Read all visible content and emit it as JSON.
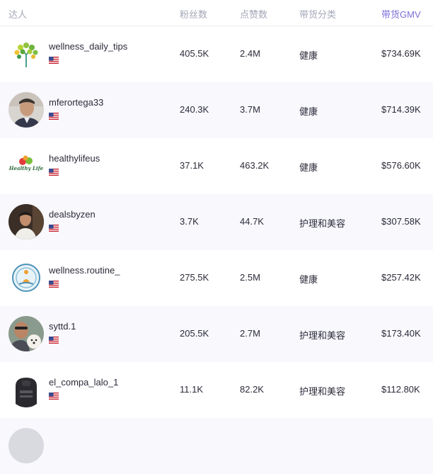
{
  "columns": {
    "creator": "达人",
    "followers": "粉丝数",
    "likes": "点赞数",
    "category": "带货分类",
    "gmv": "带货GMV"
  },
  "colors": {
    "accent": "#7b6fd8",
    "header_text": "#a3a7b7",
    "row_alt": "#f8f8fd"
  },
  "rows": [
    {
      "name": "wellness_daily_tips",
      "country_icon": "us-flag-icon",
      "followers": "405.5K",
      "likes": "2.4M",
      "category": "健康",
      "gmv": "$734.69K"
    },
    {
      "name": "mferortega33",
      "country_icon": "us-flag-icon",
      "followers": "240.3K",
      "likes": "3.7M",
      "category": "健康",
      "gmv": "$714.39K"
    },
    {
      "name": "healthylifeus",
      "country_icon": "us-flag-icon",
      "followers": "37.1K",
      "likes": "463.2K",
      "category": "健康",
      "gmv": "$576.60K",
      "logo_text": "Healthy Life"
    },
    {
      "name": "dealsbyzen",
      "country_icon": "us-flag-icon",
      "followers": "3.7K",
      "likes": "44.7K",
      "category": "护理和美容",
      "gmv": "$307.58K"
    },
    {
      "name": "wellness.routine_",
      "country_icon": "us-flag-icon",
      "followers": "275.5K",
      "likes": "2.5M",
      "category": "健康",
      "gmv": "$257.42K"
    },
    {
      "name": "syttd.1",
      "country_icon": "us-flag-icon",
      "followers": "205.5K",
      "likes": "2.7M",
      "category": "护理和美容",
      "gmv": "$173.40K"
    },
    {
      "name": "el_compa_lalo_1",
      "country_icon": "us-flag-icon",
      "followers": "11.1K",
      "likes": "82.2K",
      "category": "护理和美容",
      "gmv": "$112.80K"
    }
  ]
}
